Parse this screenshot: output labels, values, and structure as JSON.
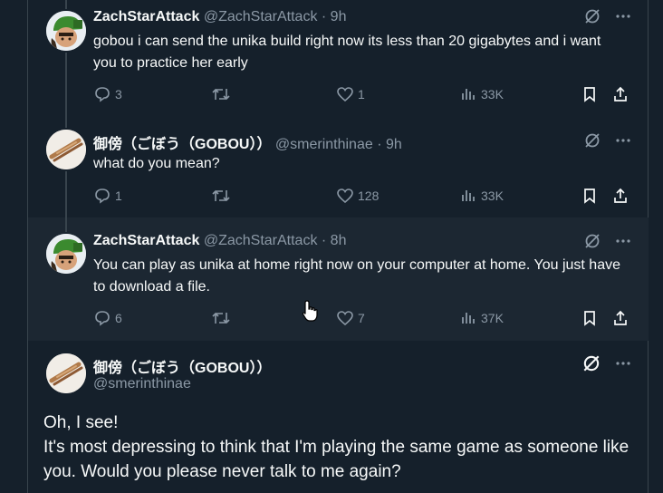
{
  "tweets": [
    {
      "name": "ZachStarAttack",
      "meta": "@ZachStarAttack · 9h",
      "text": "gobou i can send the unika build right now its less than 20 gigabytes and i want you to practice her early",
      "replies": "3",
      "retweets": "",
      "likes": "1",
      "views": "33K"
    },
    {
      "name": "御傍（ごぼう（GOBOU））",
      "meta": "@smerinthinae · 9h",
      "text": "what do you mean?",
      "replies": "1",
      "retweets": "",
      "likes": "128",
      "views": "33K"
    },
    {
      "name": "ZachStarAttack",
      "meta": "@ZachStarAttack · 8h",
      "text": "You can play as unika at home right now on your computer at home. You just have to download a file.",
      "replies": "6",
      "retweets": "",
      "likes": "7",
      "views": "37K"
    }
  ],
  "main_tweet": {
    "name": "御傍（ごぼう（GOBOU））",
    "handle": "@smerinthinae",
    "line1": "Oh, I see!",
    "line2": "It's most depressing to think that I'm playing the same game as someone like you. Would you please never talk to me again?"
  },
  "icons": {
    "grok": "grok-icon",
    "more": "more-icon",
    "reply": "reply-icon",
    "retweet": "retweet-icon",
    "like": "like-icon",
    "views": "views-icon",
    "bookmark": "bookmark-icon",
    "share": "share-icon"
  },
  "colors": {
    "background": "#15202b",
    "highlight": "#1c2732",
    "text": "#f7f9f9",
    "secondary": "#8b98a5"
  }
}
